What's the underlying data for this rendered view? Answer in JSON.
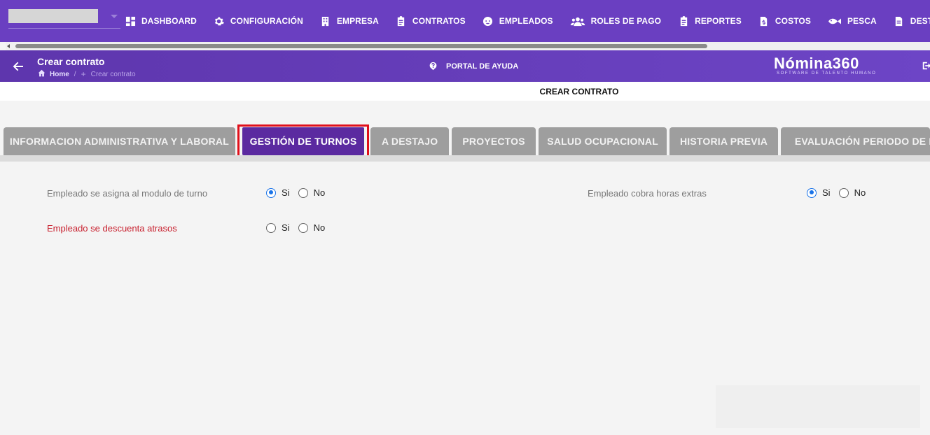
{
  "nav": {
    "company_selected": "",
    "items": [
      {
        "label": "DASHBOARD",
        "icon": "dashboard-icon"
      },
      {
        "label": "CONFIGURACIÓN",
        "icon": "gear-icon"
      },
      {
        "label": "EMPRESA",
        "icon": "building-icon"
      },
      {
        "label": "CONTRATOS",
        "icon": "clipboard-icon"
      },
      {
        "label": "EMPLEADOS",
        "icon": "face-icon"
      },
      {
        "label": "ROLES DE PAGO",
        "icon": "users-icon"
      },
      {
        "label": "REPORTES",
        "icon": "clipboard-icon"
      },
      {
        "label": "COSTOS",
        "icon": "file-dollar-icon"
      },
      {
        "label": "PESCA",
        "icon": "fish-icon"
      },
      {
        "label": "DESTAJO",
        "icon": "file-icon"
      }
    ]
  },
  "header": {
    "title": "Crear contrato",
    "breadcrumb_home": "Home",
    "breadcrumb_sep": "/",
    "breadcrumb_plus": "+",
    "breadcrumb_current": "Crear contrato",
    "help_label": "PORTAL DE AYUDA",
    "brand_name": "Nómina360",
    "brand_tagline": "SOFTWARE DE TALENTO HUMANO"
  },
  "page_title": "CREAR CONTRATO",
  "tabs": [
    {
      "label": "INFORMACION ADMINISTRATIVA Y LABORAL",
      "active": false
    },
    {
      "label": "GESTIÓN DE TURNOS",
      "active": true
    },
    {
      "label": "A DESTAJO",
      "active": false
    },
    {
      "label": "PROYECTOS",
      "active": false
    },
    {
      "label": "SALUD OCUPACIONAL",
      "active": false
    },
    {
      "label": "HISTORIA PREVIA",
      "active": false
    },
    {
      "label": "EVALUACIÓN PERIODO DE PRUEBA",
      "active": false
    }
  ],
  "form": {
    "turno": {
      "label": "Empleado se asigna al modulo de turno",
      "si": "Si",
      "no": "No",
      "value": "Si"
    },
    "horas_extras": {
      "label": "Empleado cobra horas extras",
      "si": "Si",
      "no": "No",
      "value": "Si"
    },
    "atrasos": {
      "label": "Empleado se descuenta atrasos",
      "si": "Si",
      "no": "No",
      "value": ""
    }
  },
  "colors": {
    "nav_bg": "#6a3fc1",
    "active_tab": "#5b2aa0",
    "inactive_tab": "#9e9e9e",
    "highlight_frame": "#e0101b",
    "radio_checked": "#1a73e8",
    "required_label": "#c8202e"
  }
}
